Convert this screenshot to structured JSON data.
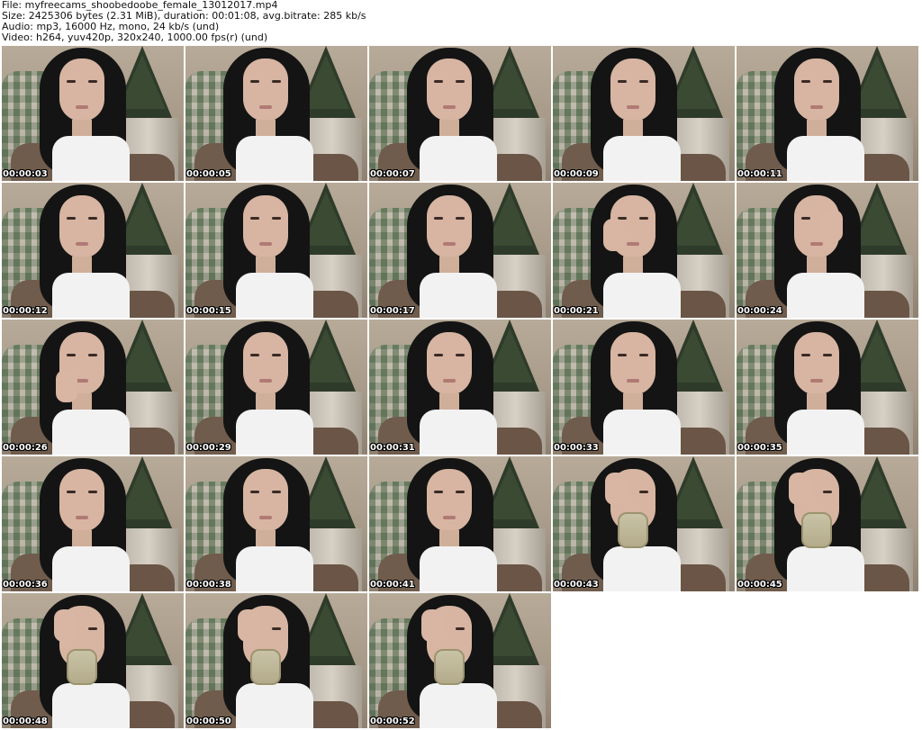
{
  "header": {
    "file_line": "File: myfreecams_shoobedoobe_female_13012017.mp4",
    "size_line": "Size: 2425306 bytes (2.31 MiB), duration: 00:01:08, avg.bitrate: 285 kb/s",
    "audio_line": "Audio: mp3, 16000 Hz, mono, 24 kb/s (und)",
    "video_line": "Video: h264, yuv420p, 320x240, 1000.00 fps(r) (und)"
  },
  "thumbnails": [
    {
      "timestamp": "00:00:03",
      "pose": "normal"
    },
    {
      "timestamp": "00:00:05",
      "pose": "normal"
    },
    {
      "timestamp": "00:00:07",
      "pose": "normal"
    },
    {
      "timestamp": "00:00:09",
      "pose": "normal"
    },
    {
      "timestamp": "00:00:11",
      "pose": "normal"
    },
    {
      "timestamp": "00:00:12",
      "pose": "normal"
    },
    {
      "timestamp": "00:00:15",
      "pose": "normal"
    },
    {
      "timestamp": "00:00:17",
      "pose": "normal"
    },
    {
      "timestamp": "00:00:21",
      "pose": "hand-left"
    },
    {
      "timestamp": "00:00:24",
      "pose": "hand-right"
    },
    {
      "timestamp": "00:00:26",
      "pose": "hand-chin"
    },
    {
      "timestamp": "00:00:29",
      "pose": "normal"
    },
    {
      "timestamp": "00:00:31",
      "pose": "normal"
    },
    {
      "timestamp": "00:00:33",
      "pose": "normal"
    },
    {
      "timestamp": "00:00:35",
      "pose": "normal"
    },
    {
      "timestamp": "00:00:36",
      "pose": "normal"
    },
    {
      "timestamp": "00:00:38",
      "pose": "normal"
    },
    {
      "timestamp": "00:00:41",
      "pose": "normal"
    },
    {
      "timestamp": "00:00:43",
      "pose": "mirror"
    },
    {
      "timestamp": "00:00:45",
      "pose": "mirror"
    },
    {
      "timestamp": "00:00:48",
      "pose": "mirror"
    },
    {
      "timestamp": "00:00:50",
      "pose": "mirror"
    },
    {
      "timestamp": "00:00:52",
      "pose": "mirror"
    }
  ]
}
